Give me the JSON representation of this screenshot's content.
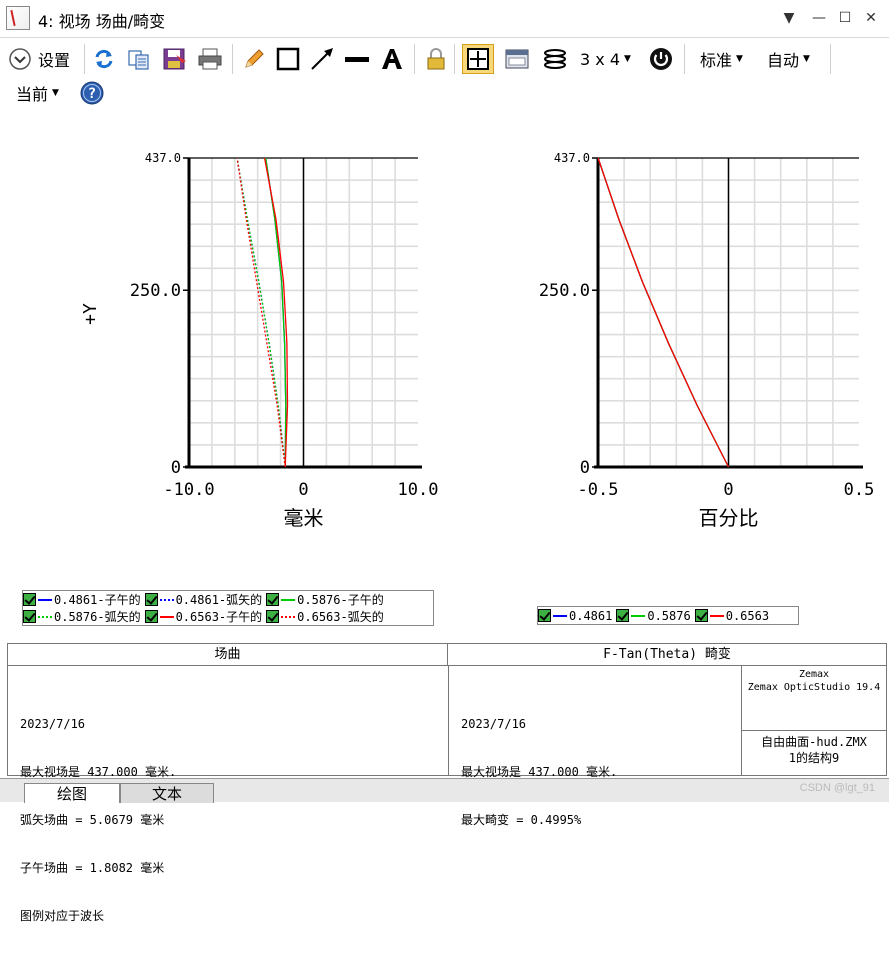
{
  "window": {
    "title": "4: 视场 场曲/畸变"
  },
  "toolbar": {
    "settings_label": "设置",
    "layout_label": "3 x 4",
    "standard_label": "标准",
    "auto_label": "自动",
    "current_label": "当前"
  },
  "chart_data": [
    {
      "type": "line",
      "title": "",
      "xlabel": "毫米",
      "ylabel": "+Y",
      "xlim": [
        -10.0,
        10.0
      ],
      "ylim": [
        0,
        437.0
      ],
      "xtick_labels": [
        "-10.0",
        "0",
        "10.0"
      ],
      "ytick_labels": [
        "0",
        "250.0",
        "437.0"
      ],
      "grid": true,
      "series": [
        {
          "name": "0.4861-子午的",
          "color": "#0000ff",
          "style": "solid",
          "x": [
            -1.6,
            -1.55,
            -1.65,
            -1.9,
            -2.5,
            -3.3
          ],
          "y": [
            0,
            87,
            175,
            262,
            350,
            437
          ]
        },
        {
          "name": "0.4861-弧矢的",
          "color": "#0000ff",
          "style": "dotted",
          "x": [
            -1.6,
            -2.2,
            -3.0,
            -3.9,
            -4.9,
            -5.8
          ],
          "y": [
            0,
            87,
            175,
            262,
            350,
            437
          ]
        },
        {
          "name": "0.5876-子午的",
          "color": "#00cc00",
          "style": "solid",
          "x": [
            -1.6,
            -1.55,
            -1.65,
            -1.9,
            -2.5,
            -3.3
          ],
          "y": [
            0,
            87,
            175,
            262,
            350,
            437
          ]
        },
        {
          "name": "0.5876-弧矢的",
          "color": "#00cc00",
          "style": "dotted",
          "x": [
            -1.6,
            -2.2,
            -3.0,
            -3.9,
            -4.9,
            -5.8
          ],
          "y": [
            0,
            87,
            175,
            262,
            350,
            437
          ]
        },
        {
          "name": "0.6563-子午的",
          "color": "#ff0000",
          "style": "solid",
          "x": [
            -1.6,
            -1.4,
            -1.45,
            -1.75,
            -2.4,
            -3.4
          ],
          "y": [
            0,
            87,
            175,
            262,
            350,
            437
          ]
        },
        {
          "name": "0.6563-弧矢的",
          "color": "#ff0000",
          "style": "dotted",
          "x": [
            -1.6,
            -2.3,
            -3.2,
            -4.1,
            -5.0,
            -5.8
          ],
          "y": [
            0,
            87,
            175,
            262,
            350,
            437
          ]
        }
      ]
    },
    {
      "type": "line",
      "title": "",
      "xlabel": "百分比",
      "ylabel": "",
      "xlim": [
        -0.5,
        0.5
      ],
      "ylim": [
        0,
        437.0
      ],
      "xtick_labels": [
        "-0.5",
        "0",
        "0.5"
      ],
      "ytick_labels": [
        "0",
        "250.0",
        "437.0"
      ],
      "grid": true,
      "series": [
        {
          "name": "0.4861",
          "color": "#0000ff",
          "style": "solid",
          "x": [
            0,
            -0.12,
            -0.23,
            -0.33,
            -0.42,
            -0.4995
          ],
          "y": [
            0,
            87,
            175,
            262,
            350,
            437
          ]
        },
        {
          "name": "0.5876",
          "color": "#00cc00",
          "style": "solid",
          "x": [
            0,
            -0.12,
            -0.23,
            -0.33,
            -0.42,
            -0.4995
          ],
          "y": [
            0,
            87,
            175,
            262,
            350,
            437
          ]
        },
        {
          "name": "0.6563",
          "color": "#ff0000",
          "style": "solid",
          "x": [
            0,
            -0.12,
            -0.23,
            -0.33,
            -0.42,
            -0.4995
          ],
          "y": [
            0,
            87,
            175,
            262,
            350,
            437
          ]
        }
      ]
    }
  ],
  "info": {
    "left_header": "场曲",
    "right_header": "F-Tan(Theta) 畸变",
    "left_lines": [
      "2023/7/16",
      "最大视场是 437.000 毫米.",
      "弧矢场曲 = 5.0679 毫米",
      "子午场曲 = 1.8082 毫米",
      "图例对应于波长"
    ],
    "right_lines": [
      "2023/7/16",
      "最大视场是 437.000 毫米.",
      "最大畸变 = 0.4995%"
    ],
    "brand_line1": "Zemax",
    "brand_line2": "Zemax OpticStudio 19.4",
    "file_line1": "自由曲面-hud.ZMX",
    "file_line2": "1的结构9"
  },
  "tabs": {
    "graph": "绘图",
    "text": "文本"
  },
  "watermark": "CSDN @lgt_91"
}
